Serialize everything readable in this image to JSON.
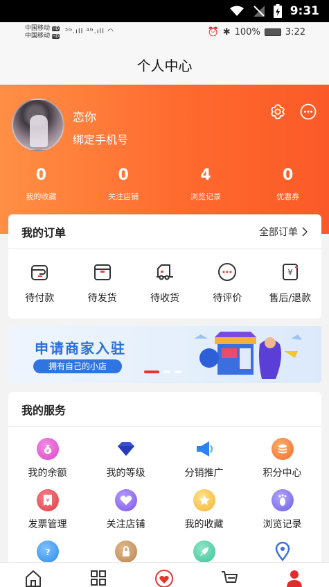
{
  "system": {
    "time": "9:31"
  },
  "inner_status": {
    "carrier1": "中国移动",
    "carrier2": "中国移动",
    "signal_text": "⁵ᴳ.ıll ⁴ᴳ.ıll",
    "battery": "100%",
    "time": "3:22"
  },
  "page": {
    "title": "个人中心"
  },
  "profile": {
    "nickname": "恋你",
    "bind_phone": "绑定手机号",
    "stats": [
      {
        "value": "0",
        "label": "我的收藏"
      },
      {
        "value": "0",
        "label": "关注店铺"
      },
      {
        "value": "4",
        "label": "浏览记录"
      },
      {
        "value": "0",
        "label": "优惠券"
      }
    ]
  },
  "orders": {
    "title": "我的订单",
    "all_link": "全部订单",
    "items": [
      {
        "label": "待付款",
        "icon": "wallet-icon"
      },
      {
        "label": "待发货",
        "icon": "box-icon"
      },
      {
        "label": "待收货",
        "icon": "truck-icon"
      },
      {
        "label": "待评价",
        "icon": "comment-icon"
      },
      {
        "label": "售后/退款",
        "icon": "refund-icon"
      }
    ]
  },
  "banner": {
    "title": "申请商家入驻",
    "subtitle": "拥有自己的小店",
    "active_slide": 1,
    "slide_count": 3
  },
  "services": {
    "title": "我的服务",
    "items": [
      {
        "label": "我的余额",
        "icon": "money-bag-icon",
        "color": "#e24fd0"
      },
      {
        "label": "我的等级",
        "icon": "diamond-icon",
        "color": "#3b4fd6"
      },
      {
        "label": "分销推广",
        "icon": "megaphone-icon",
        "color": "#2a84f0"
      },
      {
        "label": "积分中心",
        "icon": "coins-icon",
        "color": "#f07a35"
      },
      {
        "label": "发票管理",
        "icon": "invoice-icon",
        "color": "#e5484d"
      },
      {
        "label": "关注店铺",
        "icon": "heart-icon",
        "color": "#8a64e8"
      },
      {
        "label": "我的收藏",
        "icon": "star-icon",
        "color": "#f5b93a"
      },
      {
        "label": "浏览记录",
        "icon": "footprint-icon",
        "color": "#7b6de6"
      }
    ],
    "partial_row_icons": [
      "help-icon",
      "lock-icon",
      "rocket-icon",
      "location-icon"
    ]
  },
  "bottom_nav": [
    "home-icon",
    "category-icon",
    "favorites-icon",
    "cart-icon",
    "profile-icon"
  ],
  "colors": {
    "accent": "#ff6a2e",
    "active_nav": "#e02c2c"
  }
}
